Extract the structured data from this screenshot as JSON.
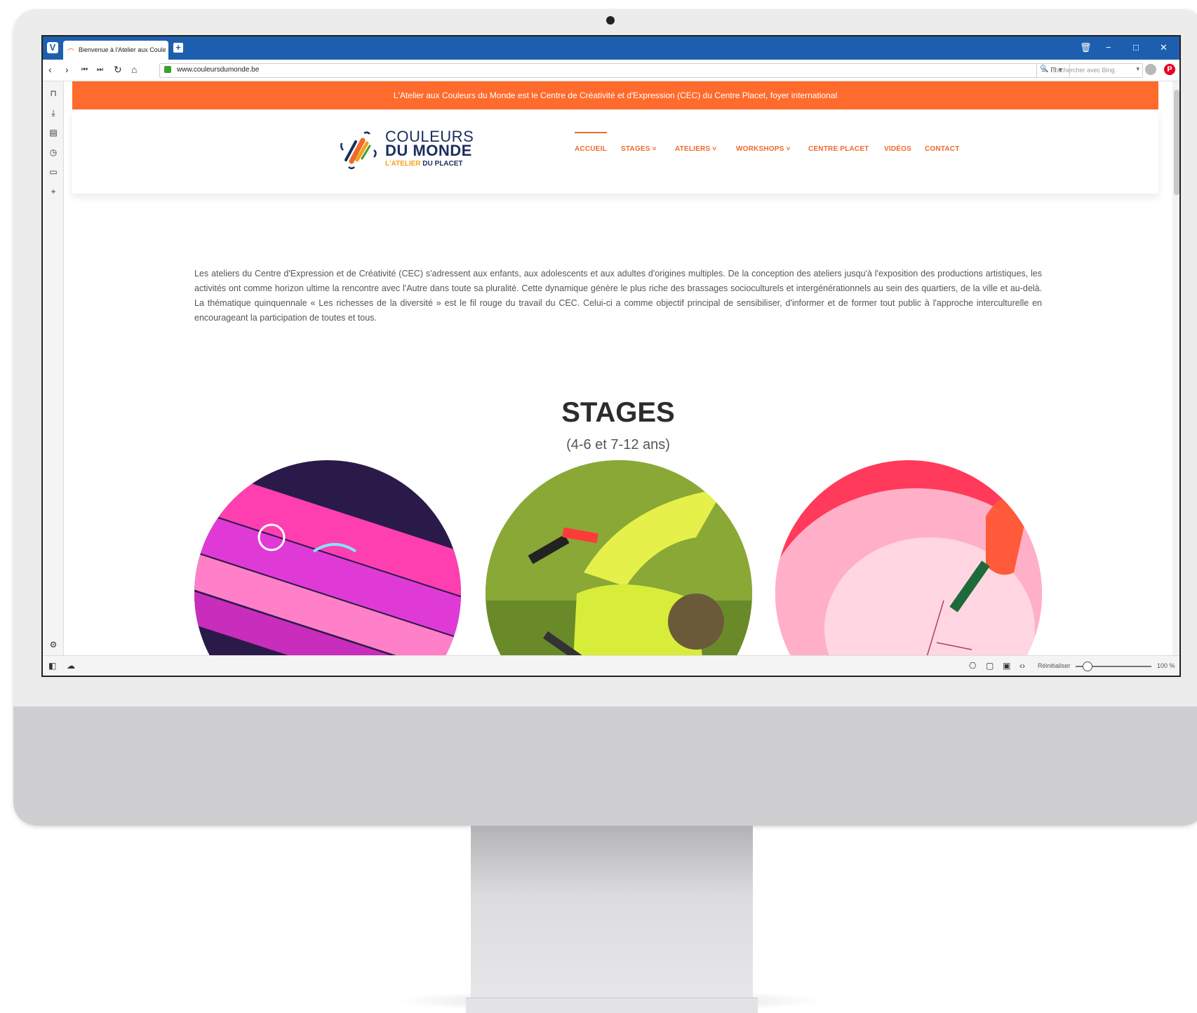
{
  "browser": {
    "tab_title": "Bienvenue à l'Atelier aux Couleurs du Monde",
    "url": "www.couleursdumonde.be",
    "search_placeholder": "Rechercher avec Bing",
    "reset_label": "Réinitialiser",
    "zoom": "100 %",
    "zoom_level": 0.15
  },
  "page": {
    "banner": "L'Atelier aux Couleurs du Monde est le Centre de Créativité et d'Expression (CEC) du Centre Placet, foyer international",
    "logo": {
      "line1": "COULEURS",
      "line2": "DU MONDE",
      "line3_a": "L'ATELIER",
      "line3_b": " DU PLACET"
    },
    "nav": [
      {
        "label": "ACCUEIL"
      },
      {
        "label": "STAGES"
      },
      {
        "label": "ATELIERS"
      },
      {
        "label": "WORKSHOPS"
      },
      {
        "label": "CENTRE PLACET"
      },
      {
        "label": "VIDÉOS"
      },
      {
        "label": "CONTACT"
      }
    ],
    "intro": "Les ateliers du Centre d'Expression et de Créativité (CEC) s'adressent aux enfants, aux adolescents et aux adultes d'origines multiples. De la conception des ateliers jusqu'à l'exposition des productions artistiques, les activités ont comme horizon ultime la rencontre avec l'Autre dans toute sa pluralité. Cette dynamique génère le plus riche des brassages socioculturels et intergénérationnels au sein des quartiers, de la ville et au-delà. La thématique quinquennale « Les richesses de la diversité » est le fil rouge du travail du CEC. Celui-ci a comme objectif principal de sensibiliser, d'informer et de former tout public à l'approche interculturelle en encourageant la participation de toutes et tous.",
    "stages_title": "STAGES",
    "stages_subtitle": "(4-6 et 7-12 ans)"
  },
  "colors": {
    "accent": "#ff6b2c",
    "browser_chrome": "#1d5fae",
    "logo_navy": "#1c2e5c"
  }
}
